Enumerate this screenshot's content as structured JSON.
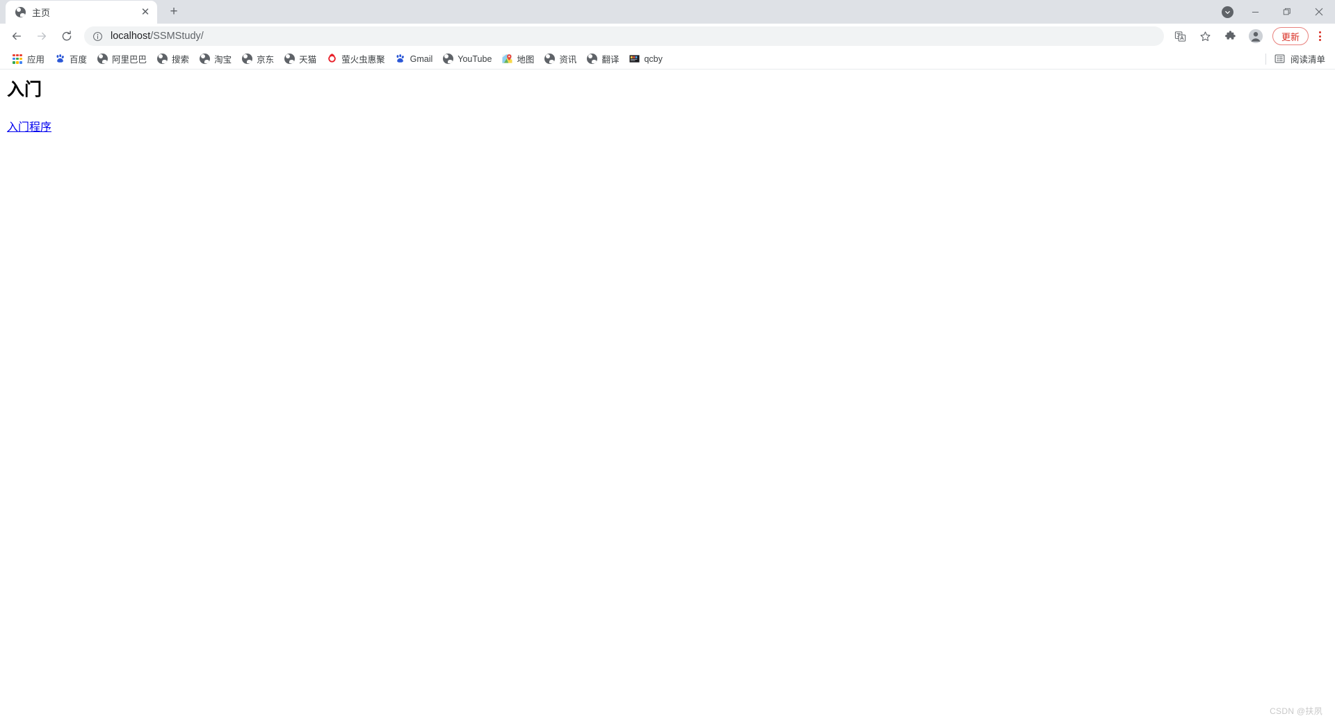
{
  "window": {
    "controls": {
      "download_badge": "download-badge",
      "minimize": "minimize",
      "maximize": "maximize",
      "close": "close"
    }
  },
  "tabstrip": {
    "tabs": [
      {
        "title": "主页",
        "favicon": "globe-icon",
        "active": true
      }
    ],
    "close_glyph": "✕",
    "newtab_glyph": "+"
  },
  "toolbar": {
    "back": "back-arrow",
    "forward": "forward-arrow",
    "reload": "reload",
    "omnibox": {
      "security_icon": "info-circle-icon",
      "host": "localhost",
      "path": "/SSMStudy/",
      "full_url": "localhost/SSMStudy/"
    },
    "translate_icon": "translate-icon",
    "bookmark_star": "star-icon",
    "extensions_icon": "puzzle-icon",
    "profile_icon": "avatar-icon",
    "update_label": "更新",
    "menu": "three-dot-menu"
  },
  "bookmarks": {
    "items": [
      {
        "label": "应用",
        "icon": "apps-grid-icon"
      },
      {
        "label": "百度",
        "icon": "baidu-paw-icon"
      },
      {
        "label": "阿里巴巴",
        "icon": "globe-icon"
      },
      {
        "label": "搜索",
        "icon": "globe-icon"
      },
      {
        "label": "淘宝",
        "icon": "globe-icon"
      },
      {
        "label": "京东",
        "icon": "globe-icon"
      },
      {
        "label": "天猫",
        "icon": "globe-icon"
      },
      {
        "label": "萤火虫惠聚",
        "icon": "red-ring-icon"
      },
      {
        "label": "Gmail",
        "icon": "baidu-paw-icon"
      },
      {
        "label": "YouTube",
        "icon": "globe-icon"
      },
      {
        "label": "地图",
        "icon": "maps-pin-icon"
      },
      {
        "label": "资讯",
        "icon": "globe-icon"
      },
      {
        "label": "翻译",
        "icon": "globe-icon"
      },
      {
        "label": "qcby",
        "icon": "qcby-icon"
      }
    ],
    "reading_list": {
      "label": "阅读清单",
      "icon": "reading-list-icon"
    }
  },
  "page": {
    "heading": "入门",
    "link": "入门程序"
  },
  "watermark": "CSDN @扶夙",
  "colors": {
    "tabstrip_bg": "#dee1e6",
    "omnibox_bg": "#f1f3f4",
    "update_accent": "#d93025",
    "link": "#0000ee",
    "text": "#3c4043"
  }
}
